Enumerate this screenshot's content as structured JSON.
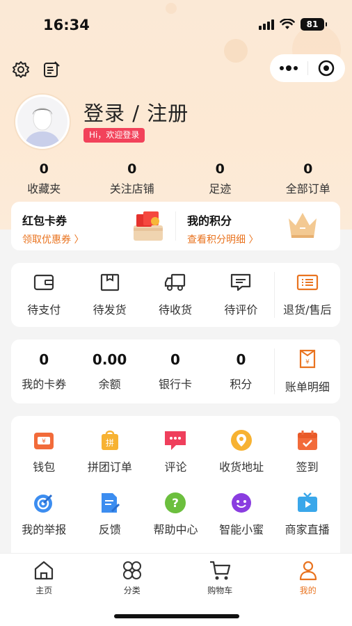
{
  "status_bar": {
    "time": "16:34",
    "battery": "81"
  },
  "profile": {
    "login_label": "登录 / 注册",
    "welcome_badge": "Hi，欢迎登录"
  },
  "stats": [
    {
      "value": "0",
      "label": "收藏夹"
    },
    {
      "value": "0",
      "label": "关注店铺"
    },
    {
      "value": "0",
      "label": "足迹"
    },
    {
      "value": "0",
      "label": "全部订单"
    }
  ],
  "coupon": {
    "left_title": "红包卡券",
    "left_link": "领取优惠券 〉",
    "right_title": "我的积分",
    "right_link": "查看积分明细 〉"
  },
  "orders": [
    {
      "label": "待支付",
      "icon": "wallet-icon"
    },
    {
      "label": "待发货",
      "icon": "box-icon"
    },
    {
      "label": "待收货",
      "icon": "truck-icon"
    },
    {
      "label": "待评价",
      "icon": "comment-icon"
    },
    {
      "label": "退货/售后",
      "icon": "return-icon"
    }
  ],
  "assets": [
    {
      "value": "0",
      "label": "我的卡券"
    },
    {
      "value": "0.00",
      "label": "余额"
    },
    {
      "value": "0",
      "label": "银行卡"
    },
    {
      "value": "0",
      "label": "积分"
    },
    {
      "label": "账单明细",
      "icon": "bill-icon"
    }
  ],
  "services": [
    {
      "label": "钱包",
      "icon": "wallet-icon"
    },
    {
      "label": "拼团订单",
      "icon": "group-order-icon"
    },
    {
      "label": "评论",
      "icon": "comment-icon"
    },
    {
      "label": "收货地址",
      "icon": "location-icon"
    },
    {
      "label": "签到",
      "icon": "checkin-icon"
    },
    {
      "label": "我的举报",
      "icon": "report-icon"
    },
    {
      "label": "反馈",
      "icon": "feedback-icon"
    },
    {
      "label": "帮助中心",
      "icon": "help-icon"
    },
    {
      "label": "智能小蜜",
      "icon": "assistant-icon"
    },
    {
      "label": "商家直播",
      "icon": "live-icon"
    }
  ],
  "tabs": [
    {
      "label": "主页",
      "icon": "home-icon"
    },
    {
      "label": "分类",
      "icon": "category-icon"
    },
    {
      "label": "购物车",
      "icon": "cart-icon"
    },
    {
      "label": "我的",
      "icon": "user-icon",
      "active": true
    }
  ],
  "colors": {
    "accent": "#e9731f",
    "badge": "#f2425a"
  }
}
